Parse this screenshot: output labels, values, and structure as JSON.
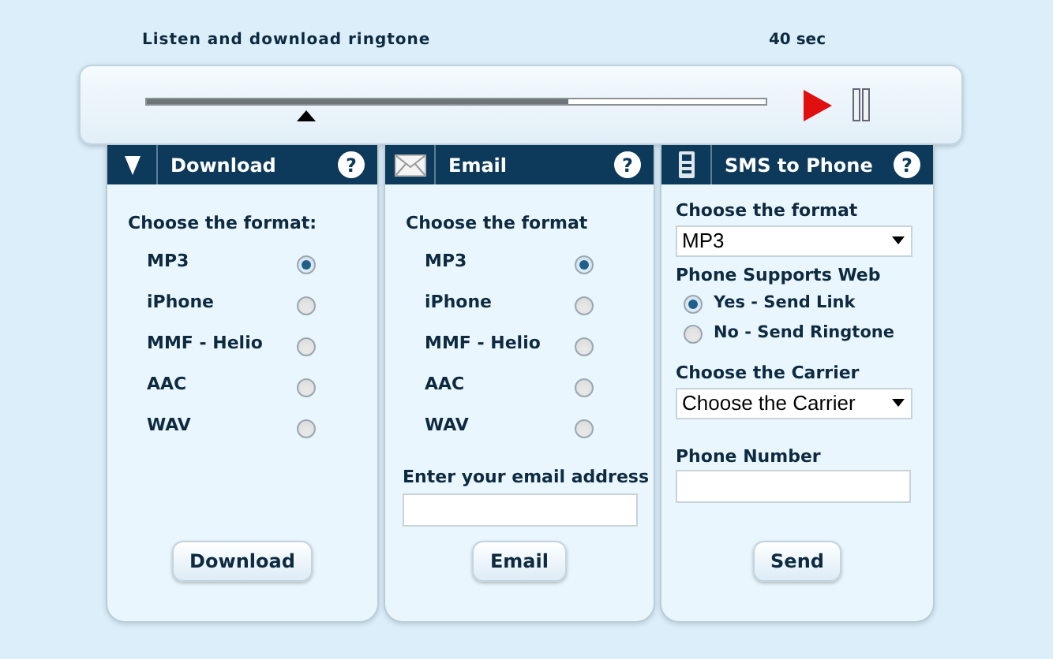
{
  "player": {
    "title": "Listen and download ringtone",
    "duration": "40 sec",
    "loaded": {
      "level": 0.68
    },
    "position": {
      "level": 0.26
    },
    "playing": true
  },
  "panels": [
    {
      "kind": "download",
      "title": "Download",
      "help": "?",
      "format_label": "Choose the format:",
      "formats": [
        {
          "label": "MP3",
          "selected": true
        },
        {
          "label": "iPhone",
          "selected": false
        },
        {
          "label": "MMF - Helio",
          "selected": false
        },
        {
          "label": "AAC",
          "selected": false
        },
        {
          "label": "WAV",
          "selected": false
        }
      ],
      "button": "Download"
    },
    {
      "kind": "email",
      "title": "Email",
      "help": "?",
      "format_label": "Choose the format",
      "formats": [
        {
          "label": "MP3",
          "selected": true
        },
        {
          "label": "iPhone",
          "selected": false
        },
        {
          "label": "MMF - Helio",
          "selected": false
        },
        {
          "label": "AAC",
          "selected": false
        },
        {
          "label": "WAV",
          "selected": false
        }
      ],
      "email_label": "Enter your email address",
      "button": "Email"
    },
    {
      "kind": "sms",
      "title": "SMS to Phone",
      "help": "?",
      "format_label": "Choose the format",
      "format_value": "MP3",
      "web_label": "Phone Supports Web",
      "web_options": [
        {
          "label": "Yes - Send Link",
          "selected": true
        },
        {
          "label": "No - Send Ringtone",
          "selected": false
        }
      ],
      "carrier_label": "Choose the Carrier",
      "carrier_value": "Choose the Carrier",
      "phone_label": "Phone Number",
      "button": "Send"
    }
  ]
}
